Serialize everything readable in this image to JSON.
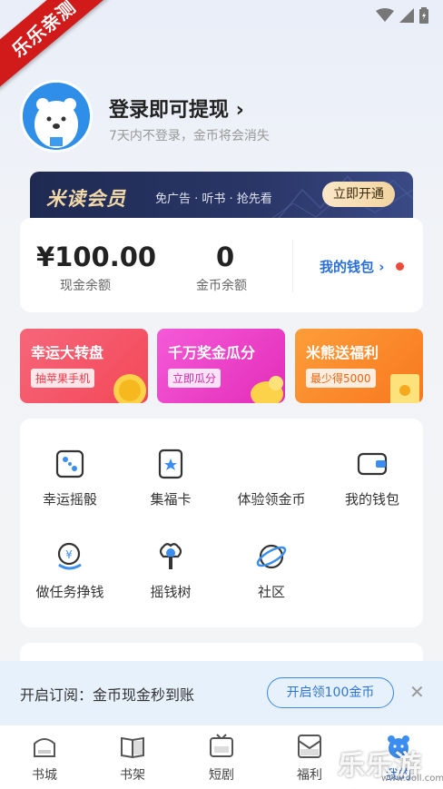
{
  "watermark": {
    "ribbon": "乐乐亲测",
    "brand": "乐乐游戏",
    "url": "www.ooll.com"
  },
  "profile": {
    "avatar_icon": "polar-bear-avatar",
    "login_title": "登录即可提现",
    "login_chevron": "›",
    "login_sub": "7天内不登录，金币将会消失"
  },
  "vip": {
    "title": "米读会员",
    "desc": "免广告 · 听书 · 抢先看",
    "button": "立即开通"
  },
  "wallet": {
    "cash_value": "¥100.00",
    "cash_label": "现金余额",
    "coin_value": "0",
    "coin_label": "金币余额",
    "link": "我的钱包 ›"
  },
  "promos": [
    {
      "title": "幸运大转盘",
      "tag": "抽苹果手机",
      "color": "#f4566b"
    },
    {
      "title": "千万奖金瓜分",
      "tag": "立即瓜分",
      "color": "#ee3fc7"
    },
    {
      "title": "米熊送福利",
      "tag": "最少得5000",
      "color": "#fb8a2a"
    }
  ],
  "grid": [
    {
      "label": "幸运摇骰",
      "icon": "dice-icon"
    },
    {
      "label": "集福卡",
      "icon": "card-icon"
    },
    {
      "label": "体验领金币",
      "icon": ""
    },
    {
      "label": "我的钱包",
      "icon": "wallet-icon"
    },
    {
      "label": "做任务挣钱",
      "icon": "task-coin-icon"
    },
    {
      "label": "摇钱树",
      "icon": "money-tree-icon"
    },
    {
      "label": "社区",
      "icon": "planet-icon"
    }
  ],
  "subscribe": {
    "text": "开启订阅：金币现金秒到账",
    "button": "开启领100金币",
    "close": "✕"
  },
  "tabs": [
    {
      "label": "书城",
      "icon": "home-icon"
    },
    {
      "label": "书架",
      "icon": "book-icon"
    },
    {
      "label": "短剧",
      "icon": "tv-icon"
    },
    {
      "label": "福利",
      "icon": "gift-envelope-icon"
    },
    {
      "label": "我的",
      "icon": "bear-icon",
      "active": true
    }
  ]
}
